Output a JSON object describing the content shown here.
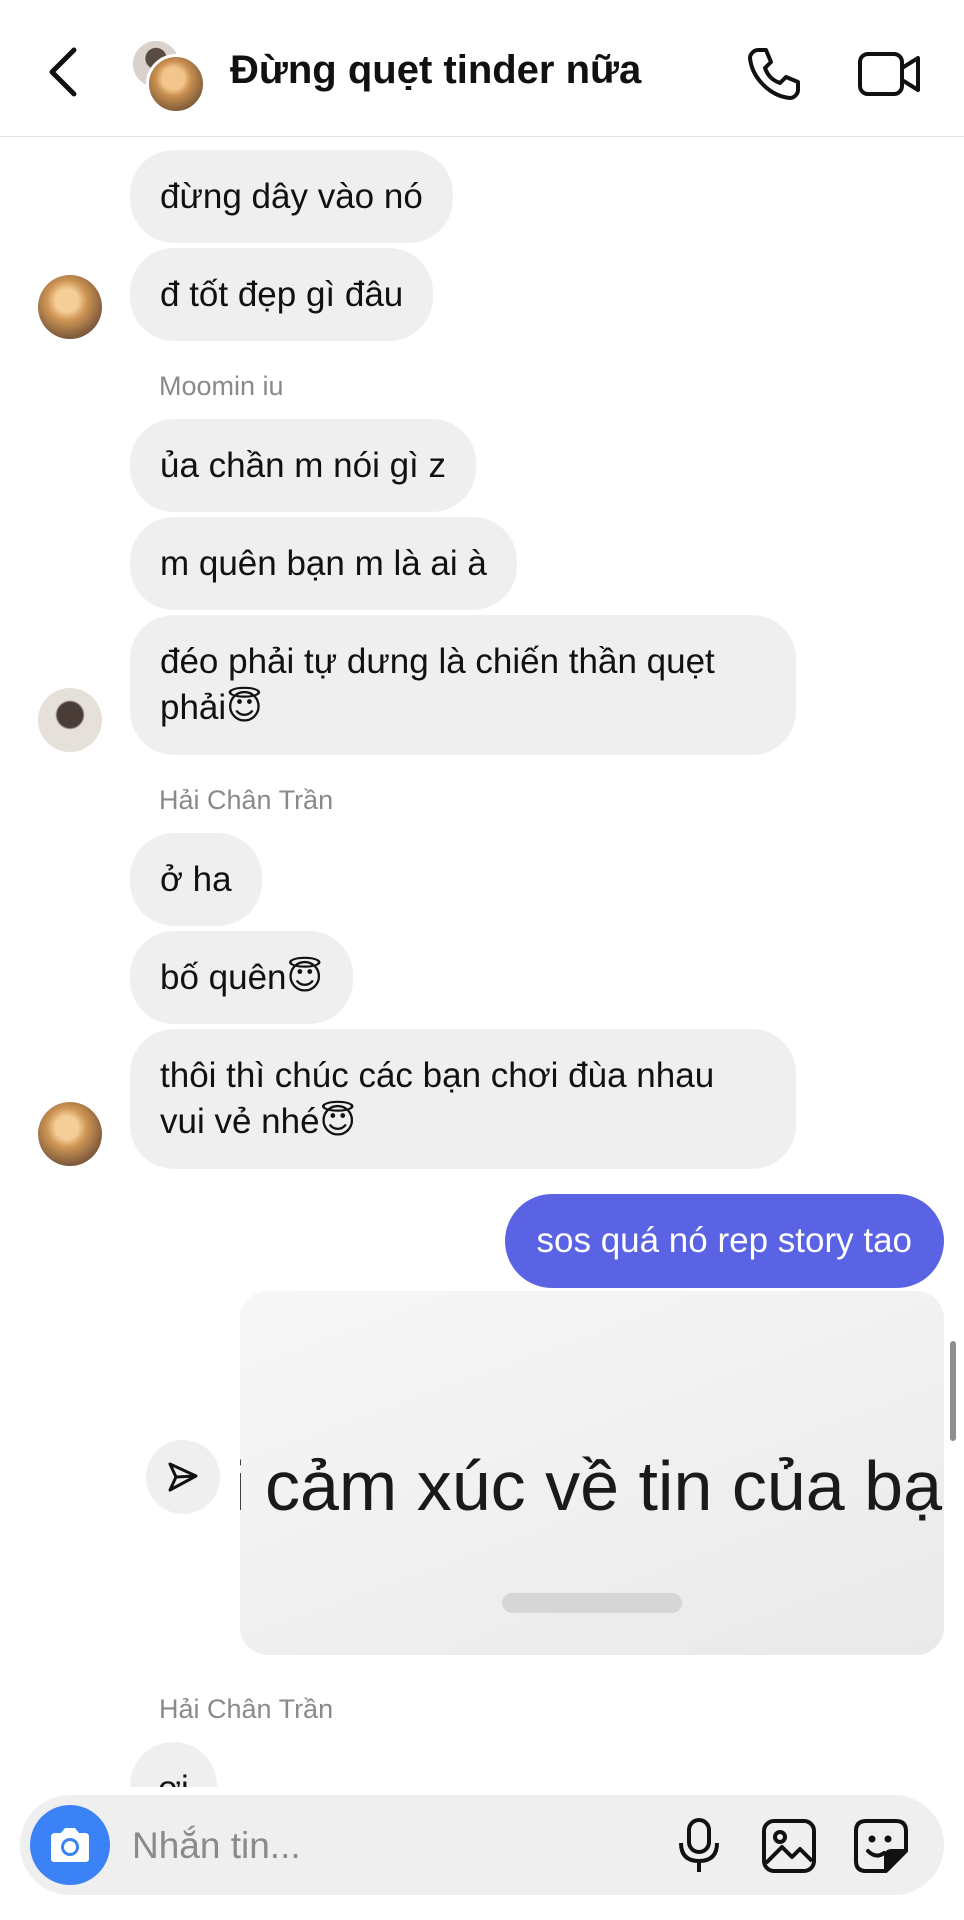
{
  "header": {
    "title": "Đừng quẹt tinder nữa"
  },
  "messages": [
    {
      "text": "đừng dây vào nó"
    },
    {
      "text": "đ tốt đẹp gì đâu"
    },
    {
      "sender": "Moomin iu"
    },
    {
      "text": "ủa chần m nói gì z"
    },
    {
      "text": "m quên bạn m là ai à"
    },
    {
      "text": "đéo phải tự dưng là chiến thần quẹt phải😇"
    },
    {
      "sender": "Hải Chân Trần"
    },
    {
      "text": "ở ha"
    },
    {
      "text": "bố quên😇"
    },
    {
      "text": "thôi thì chúc các bạn chơi đùa nhau vui vẻ nhé😇"
    }
  ],
  "outgoing": {
    "text": "sos quá nó rep story tao"
  },
  "story": {
    "text": "i cảm xúc về tin của bạ"
  },
  "last": {
    "sender": "Hải Chân Trần",
    "text": "ơi"
  },
  "composer": {
    "placeholder": "Nhắn tin..."
  },
  "icons": {
    "back": "chevron-left-icon",
    "call": "phone-icon",
    "video": "video-camera-icon",
    "share": "send-icon",
    "camera": "camera-icon",
    "mic": "microphone-icon",
    "gallery": "image-icon",
    "sticker": "sticker-icon"
  },
  "colors": {
    "outgoing_bubble": "#5a63e3",
    "incoming_bubble": "#efefef",
    "camera_button": "#3b82f6"
  }
}
